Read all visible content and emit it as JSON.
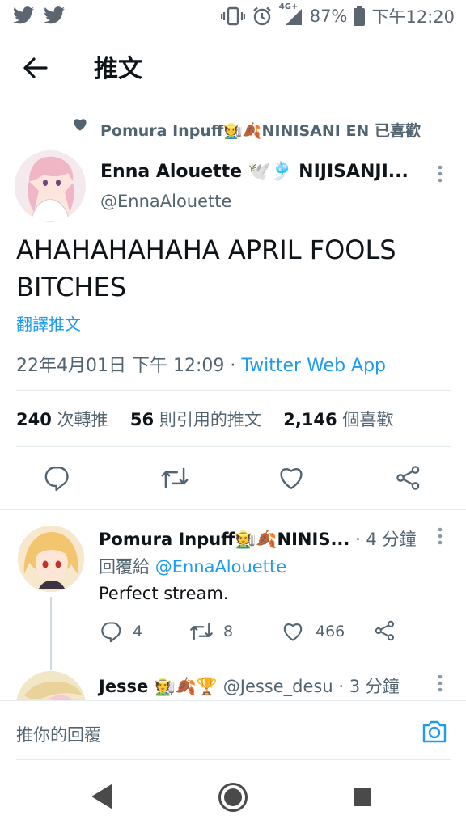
{
  "status_bar": {
    "network": "4G+",
    "battery": "87%",
    "time": "下午12:20"
  },
  "header": {
    "title": "推文"
  },
  "liked_by": {
    "text": "Pomura Inpuff🧑‍🌾🍂NINISANI EN 已喜歡"
  },
  "tweet": {
    "author_name": "Enna Alouette 🕊️🎐 NIJISANJI...",
    "handle": "@EnnaAlouette",
    "text": "AHAHAHAHAHA APRIL FOOLS BITCHES",
    "translate": "翻譯推文",
    "timestamp": "22年4月01日 下午 12:09 · ",
    "source": "Twitter Web App",
    "stats": {
      "retweets_count": "240",
      "retweets_label": " 次轉推",
      "quotes_count": "56",
      "quotes_label": " 則引用的推文",
      "likes_count": "2,146",
      "likes_label": " 個喜歡"
    }
  },
  "replies": [
    {
      "name": "Pomura Inpuff🧑‍🌾🍂NINIS...",
      "time": " · 4 分鐘",
      "reply_to_label": "回覆給 ",
      "reply_to_handle": "@EnnaAlouette",
      "text": "Perfect stream.",
      "reply_count": "4",
      "retweet_count": "8",
      "like_count": "466"
    },
    {
      "name": "Jesse 🧑‍🌾🍂🏆",
      "handle": "@Jesse_desu",
      "time": " · 3 分鐘"
    }
  ],
  "reply_bar": {
    "placeholder": "推你的回覆"
  },
  "colors": {
    "accent": "#1d9bf0",
    "text": "#0f1419",
    "secondary": "#536471"
  }
}
